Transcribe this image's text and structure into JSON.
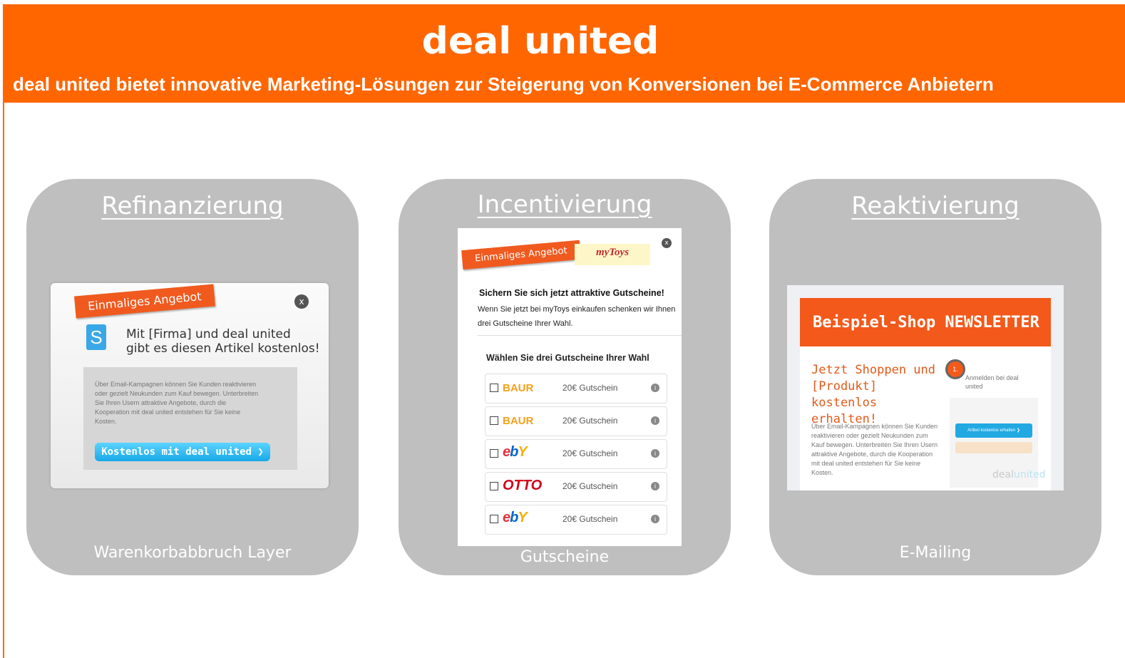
{
  "header": {
    "title": "deal united",
    "tagline": "deal united bietet innovative Marketing-Lösungen zur Steigerung von Konversionen bei E-Commerce Anbietern"
  },
  "colors": {
    "accent": "#ff6600",
    "card": "#bfbfbf"
  },
  "cards": [
    {
      "title": "Refinanzierung",
      "caption": "Warenkorbabbruch Layer",
      "mockup": {
        "ribbon": "Einmaliges Angebot",
        "close": "x",
        "logo_letter": "S",
        "headline_1": "Mit [Firma] und deal united",
        "headline_2": "gibt es diesen Artikel kostenlos!",
        "body": "Über Email-Kampagnen können Sie Kunden reaktivieren oder gezielt Neukunden zum Kauf bewegen. Unterbreiten Sie Ihren Usern attraktive Angebote, durch die Kooperation mit deal united entstehen für Sie keine Kosten.",
        "cta": "Kostenlos mit deal united ❯"
      }
    },
    {
      "title": "Incentivierung",
      "caption": "Gutscheine",
      "mockup": {
        "ribbon": "Einmaliges Angebot",
        "partner_logo": "myToys",
        "headline": "Sichern Sie sich jetzt attraktive Gutscheine!",
        "text": "Wenn Sie jetzt bei myToys einkaufen schenken wir Ihnen drei Gutscheine Ihrer Wahl.",
        "choose": "Wählen Sie drei Gutscheine Ihrer Wahl",
        "vouchers": [
          {
            "brand": "BAUR",
            "value": "20€ Gutschein"
          },
          {
            "brand": "BAUR",
            "value": "20€ Gutschein"
          },
          {
            "brand": "ebY",
            "value": "20€ Gutschein"
          },
          {
            "brand": "OTTO",
            "value": "20€ Gutschein"
          },
          {
            "brand": "ebY",
            "value": "20€ Gutschein"
          }
        ]
      }
    },
    {
      "title": "Reaktivierung",
      "caption": "E-Mailing",
      "mockup": {
        "banner": "Beispiel-Shop NEWSLETTER",
        "headline": "Jetzt Shoppen und [Produkt] kostenlos erhalten!",
        "body": "Über Email-Kampagnen können Sie Kunden reaktivieren oder gezielt Neukunden zum Kauf bewegen. Unterbreiten Sie Ihren Usern attraktive Angebote, durch die Kooperation mit deal united entstehen für Sie keine Kosten.",
        "step": "1.",
        "signup": "Anmelden bei deal united",
        "button": "Artikel kostenlos erhalten ❯",
        "logo_a": "deal",
        "logo_b": "united"
      }
    }
  ]
}
